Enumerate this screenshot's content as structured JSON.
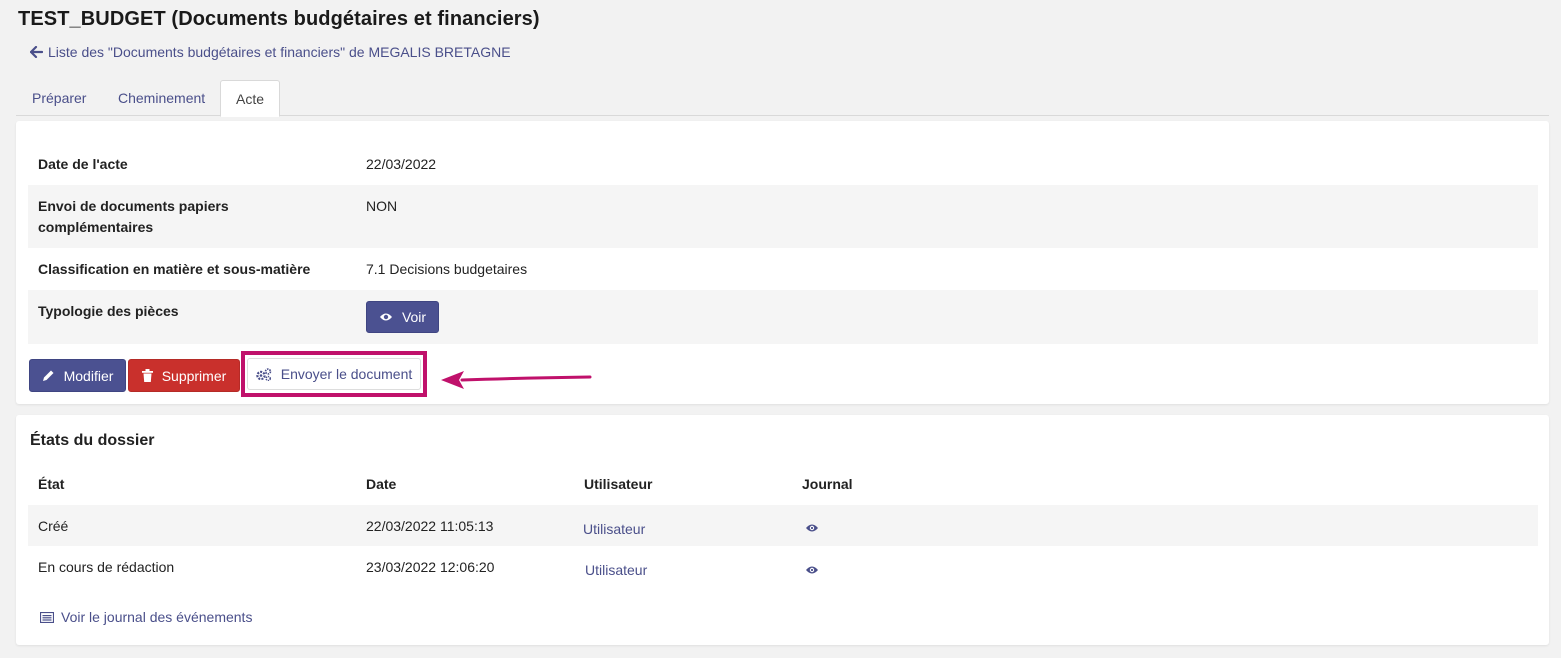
{
  "header": {
    "title": "TEST_BUDGET (Documents budgétaires et financiers)",
    "back_link": "Liste des \"Documents budgétaires et financiers\" de MEGALIS BRETAGNE"
  },
  "tabs": [
    {
      "label": "Préparer",
      "active": false
    },
    {
      "label": "Cheminement",
      "active": false
    },
    {
      "label": "Acte",
      "active": true
    }
  ],
  "details": {
    "rows": [
      {
        "label": "Date de l'acte",
        "value": "22/03/2022"
      },
      {
        "label": "Envoi de documents papiers complémentaires",
        "value": "NON"
      },
      {
        "label": "Classification en matière et sous-matière",
        "value": "7.1 Decisions budgetaires"
      },
      {
        "label": "Typologie des pièces",
        "button_label": "Voir"
      }
    ]
  },
  "actions": {
    "modify": "Modifier",
    "delete": "Supprimer",
    "send": "Envoyer le document"
  },
  "states": {
    "title": "États du dossier",
    "columns": [
      "État",
      "Date",
      "Utilisateur",
      "Journal"
    ],
    "rows": [
      {
        "state": "Créé",
        "date": "22/03/2022 11:05:13",
        "user": "Utilisateur",
        "journal_icon": "eye-icon"
      },
      {
        "state": "En cours de rédaction",
        "date": "23/03/2022 12:06:20",
        "user": "Utilisateur",
        "journal_icon": "eye-icon"
      }
    ],
    "journal_link": "Voir le journal des événements"
  },
  "colors": {
    "primary": "#4b5191",
    "danger": "#c9302c",
    "highlight": "#c0116b"
  }
}
